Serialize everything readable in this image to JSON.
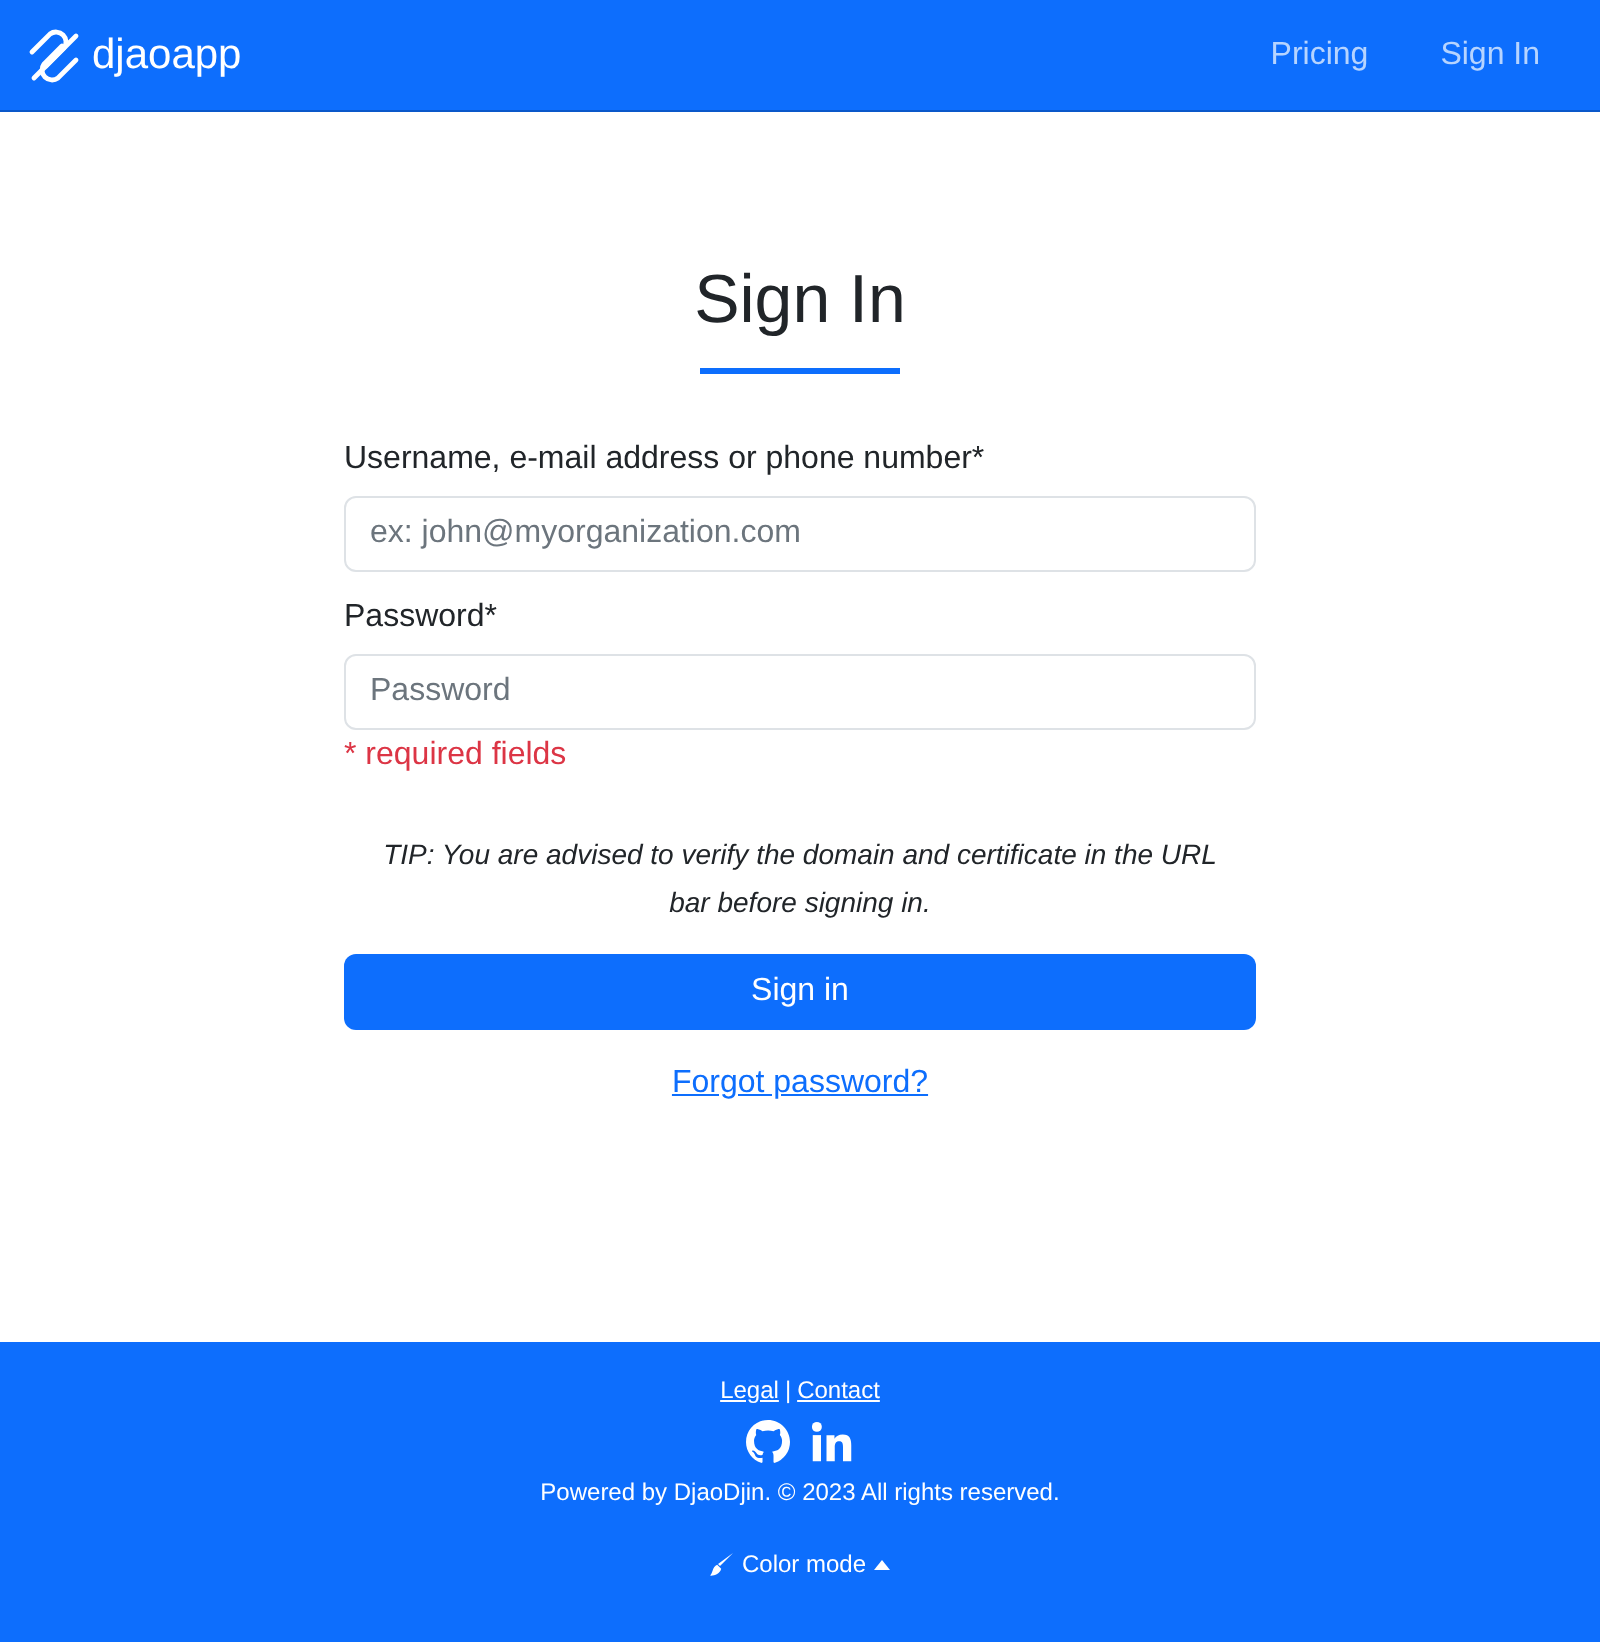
{
  "navbar": {
    "brand": "djaoapp",
    "links": [
      {
        "label": "Pricing"
      },
      {
        "label": "Sign In"
      }
    ]
  },
  "form": {
    "title": "Sign In",
    "fields": [
      {
        "label": "Username, e-mail address or phone number*",
        "placeholder": "ex: john@myorganization.com"
      },
      {
        "label": "Password*",
        "placeholder": "Password"
      }
    ],
    "required_note": "* required fields",
    "tip": "TIP: You are advised to verify the domain and certificate in the URL bar before signing in.",
    "submit": "Sign in",
    "forgot_link": "Forgot password?"
  },
  "footer": {
    "links": [
      {
        "label": "Legal"
      },
      {
        "label": "Contact"
      }
    ],
    "separator": "|",
    "social": [
      {
        "kind": "github"
      },
      {
        "kind": "linkedin"
      }
    ],
    "copyright": "Powered by DjaoDjin. © 2023 All rights reserved.",
    "color_mode": "Color mode"
  }
}
